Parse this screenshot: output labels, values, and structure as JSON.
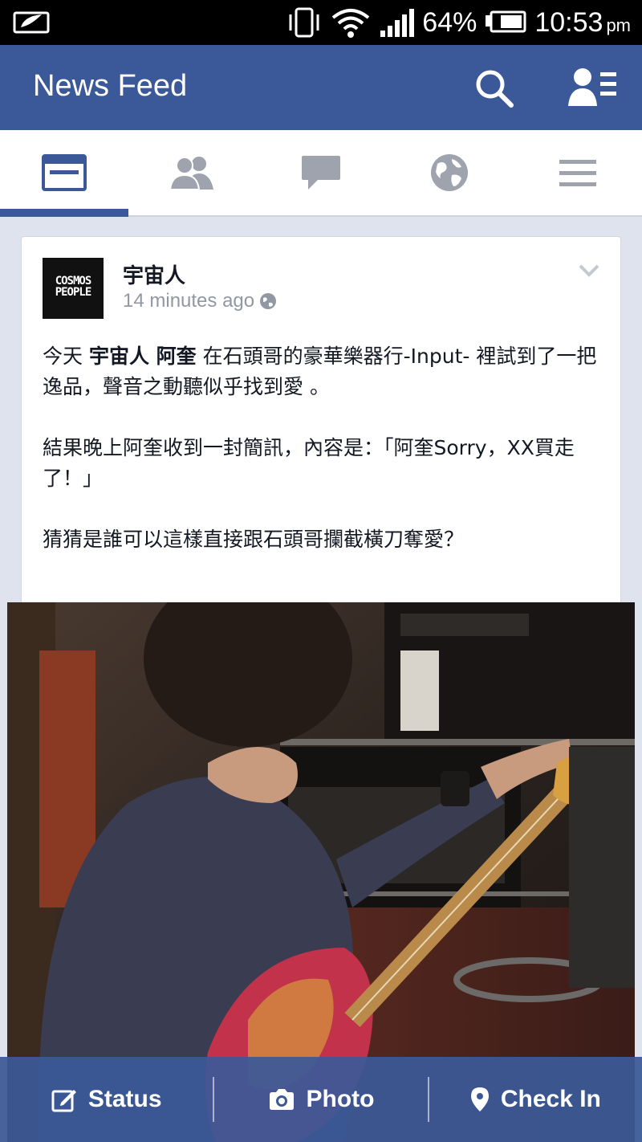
{
  "status_bar": {
    "battery_percent": "64%",
    "time": "10:53",
    "ampm": "pm"
  },
  "header": {
    "title": "News Feed",
    "bg_color": "#3b5998"
  },
  "tabs": [
    {
      "name": "news-feed",
      "icon": "news-feed-icon",
      "active": true
    },
    {
      "name": "friend-requests",
      "icon": "friends-icon",
      "active": false
    },
    {
      "name": "messages",
      "icon": "message-icon",
      "active": false
    },
    {
      "name": "notifications",
      "icon": "globe-icon",
      "active": false
    },
    {
      "name": "more",
      "icon": "menu-icon",
      "active": false
    }
  ],
  "post": {
    "author": "宇宙人",
    "avatar_text": "COSMOS PEOPLE",
    "timestamp": "14 minutes ago",
    "p1_a": "今天 ",
    "p1_b": "宇宙人 阿奎",
    "p1_c": "  在石頭哥的豪華樂器行-Input- 裡試到了一把逸品，聲音之動聽似乎找到愛 。",
    "p2": "結果晚上阿奎收到一封簡訊，內容是：「阿奎Sorry，XX買走了！」",
    "p3": "猜猜是誰可以這樣直接跟石頭哥攔截橫刀奪愛？"
  },
  "composer": {
    "status_label": "Status",
    "photo_label": "Photo",
    "checkin_label": "Check In"
  }
}
